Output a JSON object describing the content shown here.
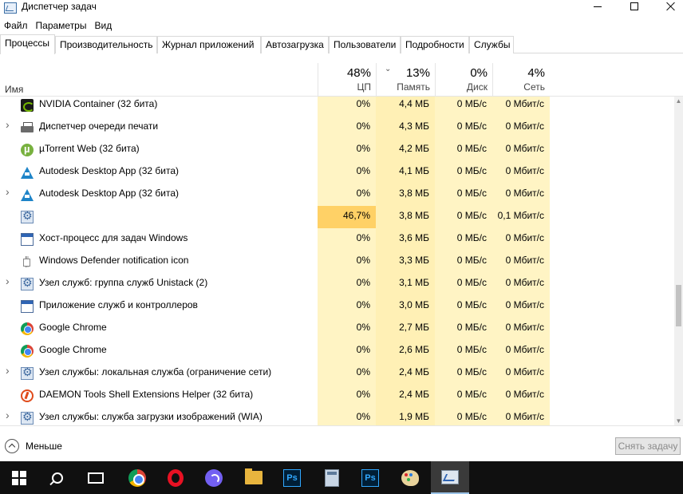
{
  "window": {
    "title": "Диспетчер задач"
  },
  "menu": [
    "Файл",
    "Параметры",
    "Вид"
  ],
  "tabs": [
    {
      "label": "Процессы",
      "active": true
    },
    {
      "label": "Производительность"
    },
    {
      "label": "Журнал приложений"
    },
    {
      "label": "Автозагрузка"
    },
    {
      "label": "Пользователи"
    },
    {
      "label": "Подробности"
    },
    {
      "label": "Службы"
    }
  ],
  "columns": {
    "name": "Имя",
    "cpu": {
      "percent": "48%",
      "label": "ЦП"
    },
    "memory": {
      "percent": "13%",
      "label": "Память",
      "sorted": "descending"
    },
    "disk": {
      "percent": "0%",
      "label": "Диск"
    },
    "network": {
      "percent": "4%",
      "label": "Сеть"
    }
  },
  "processes": [
    {
      "name": "NVIDIA Container (32 бита)",
      "icon": "nvidia-icon",
      "expandable": false,
      "cpu": "0%",
      "memory": "4,4 МБ",
      "disk": "0 МБ/с",
      "network": "0 Мбит/с"
    },
    {
      "name": "Диспетчер очереди печати",
      "icon": "printer-icon",
      "expandable": true,
      "cpu": "0%",
      "memory": "4,3 МБ",
      "disk": "0 МБ/с",
      "network": "0 Мбит/с"
    },
    {
      "name": "µTorrent Web (32 бита)",
      "icon": "utorrent-icon",
      "expandable": false,
      "cpu": "0%",
      "memory": "4,2 МБ",
      "disk": "0 МБ/с",
      "network": "0 Мбит/с"
    },
    {
      "name": "Autodesk Desktop App (32 бита)",
      "icon": "autodesk-icon",
      "expandable": false,
      "cpu": "0%",
      "memory": "4,1 МБ",
      "disk": "0 МБ/с",
      "network": "0 Мбит/с"
    },
    {
      "name": "Autodesk Desktop App (32 бита)",
      "icon": "autodesk-icon",
      "expandable": true,
      "cpu": "0%",
      "memory": "3,8 МБ",
      "disk": "0 МБ/с",
      "network": "0 Мбит/с"
    },
    {
      "name": "",
      "icon": "gear-icon",
      "expandable": false,
      "cpu": "46,7%",
      "memory": "3,8 МБ",
      "disk": "0 МБ/с",
      "network": "0,1 Мбит/с",
      "hot": true
    },
    {
      "name": "Хост-процесс для задач Windows",
      "icon": "window-icon",
      "expandable": false,
      "cpu": "0%",
      "memory": "3,6 МБ",
      "disk": "0 МБ/с",
      "network": "0 Мбит/с"
    },
    {
      "name": "Windows Defender notification icon",
      "icon": "shield-icon",
      "expandable": false,
      "cpu": "0%",
      "memory": "3,3 МБ",
      "disk": "0 МБ/с",
      "network": "0 Мбит/с"
    },
    {
      "name": "Узел служб: группа служб Unistack (2)",
      "icon": "gear-icon",
      "expandable": true,
      "cpu": "0%",
      "memory": "3,1 МБ",
      "disk": "0 МБ/с",
      "network": "0 Мбит/с"
    },
    {
      "name": "Приложение служб и контроллеров",
      "icon": "window-icon",
      "expandable": false,
      "cpu": "0%",
      "memory": "3,0 МБ",
      "disk": "0 МБ/с",
      "network": "0 Мбит/с"
    },
    {
      "name": "Google Chrome",
      "icon": "chrome-icon",
      "expandable": false,
      "cpu": "0%",
      "memory": "2,7 МБ",
      "disk": "0 МБ/с",
      "network": "0 Мбит/с"
    },
    {
      "name": "Google Chrome",
      "icon": "chrome-icon",
      "expandable": false,
      "cpu": "0%",
      "memory": "2,6 МБ",
      "disk": "0 МБ/с",
      "network": "0 Мбит/с"
    },
    {
      "name": "Узел службы: локальная служба (ограничение сети)",
      "icon": "gear-icon",
      "expandable": true,
      "cpu": "0%",
      "memory": "2,4 МБ",
      "disk": "0 МБ/с",
      "network": "0 Мбит/с"
    },
    {
      "name": "DAEMON Tools Shell Extensions Helper (32 бита)",
      "icon": "daemon-tools-icon",
      "expandable": false,
      "cpu": "0%",
      "memory": "2,4 МБ",
      "disk": "0 МБ/с",
      "network": "0 Мбит/с"
    },
    {
      "name": "Узел службы: служба загрузки изображений (WIA)",
      "icon": "gear-icon",
      "expandable": true,
      "cpu": "0%",
      "memory": "1,9 МБ",
      "disk": "0 МБ/с",
      "network": "0 Мбит/с"
    }
  ],
  "footer": {
    "less_label": "Меньше",
    "end_task_label": "Снять задачу"
  },
  "taskbar": [
    {
      "icon": "windows-start-icon"
    },
    {
      "icon": "search-icon"
    },
    {
      "icon": "task-view-icon"
    },
    {
      "icon": "chrome-icon"
    },
    {
      "icon": "opera-icon"
    },
    {
      "icon": "viber-icon"
    },
    {
      "icon": "file-explorer-icon"
    },
    {
      "icon": "photoshop-icon",
      "text": "Ps"
    },
    {
      "icon": "calculator-icon"
    },
    {
      "icon": "photoshop-icon",
      "text": "Ps"
    },
    {
      "icon": "paint-icon"
    },
    {
      "icon": "task-manager-icon",
      "active": true
    }
  ],
  "colors": {
    "cpu_column_bg": "#fff4c4",
    "memory_column_bg": "#fff0b5",
    "hot_cell_bg": "#ffd166",
    "taskbar_bg": "#101010"
  }
}
